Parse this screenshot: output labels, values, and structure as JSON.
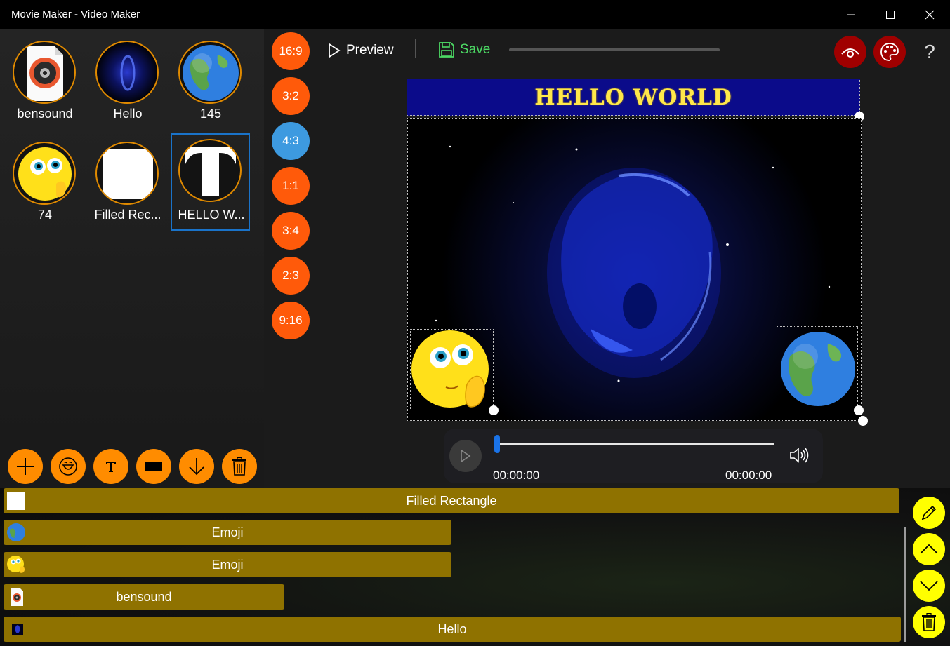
{
  "window": {
    "title": "Movie Maker - Video Maker"
  },
  "media": [
    {
      "caption": "bensound"
    },
    {
      "caption": "Hello"
    },
    {
      "caption": "145"
    },
    {
      "caption": "74"
    },
    {
      "caption": "Filled Rec..."
    },
    {
      "caption": "HELLO W..."
    }
  ],
  "aspect_ratios": [
    "16:9",
    "3:2",
    "4:3",
    "1:1",
    "3:4",
    "2:3",
    "9:16"
  ],
  "aspect_selected": "4:3",
  "toolbar": {
    "preview_label": "Preview",
    "save_label": "Save"
  },
  "canvas": {
    "title_text": "HELLO WORLD"
  },
  "player": {
    "current_time": "00:00:00",
    "total_time": "00:00:00",
    "progress": 0
  },
  "tracks": [
    {
      "label": "Filled Rectangle"
    },
    {
      "label": "Emoji"
    },
    {
      "label": "Emoji"
    },
    {
      "label": "bensound"
    },
    {
      "label": "Hello"
    }
  ],
  "colors": {
    "accent_orange": "#ff8c00",
    "ratio_orange": "#ff5a0a",
    "ratio_active": "#3d9ae0",
    "track": "#8f7200",
    "side_button": "#ffff00",
    "title_banner": "#0b0b8a",
    "title_text": "#ffe84a",
    "save_green": "#4cd964",
    "round_red": "#a00000"
  }
}
